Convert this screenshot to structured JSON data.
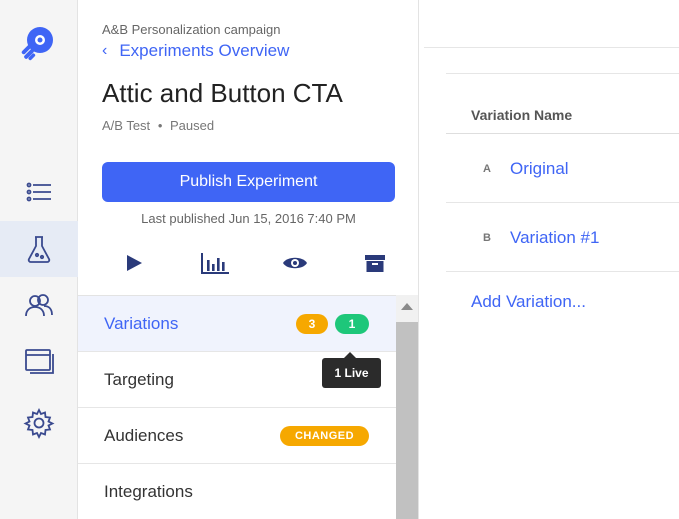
{
  "campaign": "A&B Personalization campaign",
  "back_link": "Experiments Overview",
  "experiment": {
    "title": "Attic and Button CTA",
    "type": "A/B Test",
    "separator": "•",
    "status": "Paused"
  },
  "publish_button": "Publish Experiment",
  "last_published": "Last published Jun 15, 2016 7:40 PM",
  "toolbar_icons": [
    "play-icon",
    "results-icon",
    "preview-icon",
    "archive-icon"
  ],
  "rail_icons": [
    "logo-icon",
    "list-icon",
    "flask-icon",
    "audiences-icon",
    "window-icon",
    "gear-icon"
  ],
  "nav": {
    "items": [
      {
        "label": "Variations",
        "active": true
      },
      {
        "label": "Targeting"
      },
      {
        "label": "Audiences"
      },
      {
        "label": "Integrations"
      }
    ],
    "variations_badge_count": "3",
    "variations_live_badge": "1",
    "audiences_badge": "CHANGED"
  },
  "tooltip": "1 Live",
  "variations_table": {
    "header": "Variation Name",
    "rows": [
      {
        "letter": "A",
        "name": "Original"
      },
      {
        "letter": "B",
        "name": "Variation #1"
      }
    ],
    "add_link": "Add Variation..."
  },
  "colors": {
    "accent": "#3f65f5",
    "orange": "#f6a800",
    "green": "#1ec77a",
    "tooltip": "#2b2b2b"
  }
}
